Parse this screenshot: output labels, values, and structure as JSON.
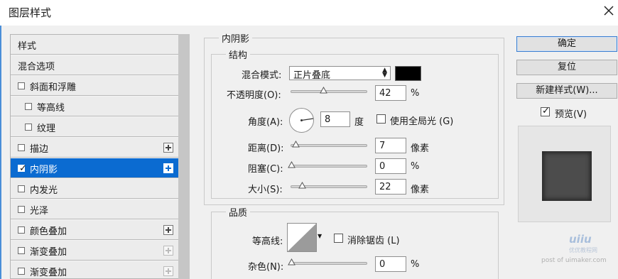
{
  "window": {
    "title": "图层样式"
  },
  "sidebar": {
    "items": [
      {
        "label": "样式",
        "type": "header"
      },
      {
        "label": "混合选项",
        "type": "header"
      },
      {
        "label": "斜面和浮雕",
        "checked": false,
        "plus": false
      },
      {
        "label": "等高线",
        "checked": false,
        "indent": true
      },
      {
        "label": "纹理",
        "checked": false,
        "indent": true
      },
      {
        "label": "描边",
        "checked": false,
        "plus": true
      },
      {
        "label": "内阴影",
        "checked": true,
        "plus": true,
        "selected": true
      },
      {
        "label": "内发光",
        "checked": false
      },
      {
        "label": "光泽",
        "checked": false
      },
      {
        "label": "颜色叠加",
        "checked": false,
        "plus": true
      },
      {
        "label": "渐变叠加",
        "checked": false,
        "plus": true,
        "dim": true
      },
      {
        "label": "渐变叠加",
        "checked": false,
        "plus": true,
        "dim": true
      }
    ]
  },
  "panel": {
    "section_title": "内阴影",
    "structure": {
      "legend": "结构",
      "blend_mode_label": "混合模式:",
      "blend_mode_value": "正片叠底",
      "blend_color": "#000000",
      "opacity_label": "不透明度(O):",
      "opacity_value": "42",
      "opacity_unit": "%",
      "angle_label": "角度(A):",
      "angle_value": "8",
      "angle_unit": "度",
      "global_light_label": "使用全局光 (G)",
      "global_light_checked": false,
      "distance_label": "距离(D):",
      "distance_value": "7",
      "distance_unit": "像素",
      "choke_label": "阻塞(C):",
      "choke_value": "0",
      "choke_unit": "%",
      "size_label": "大小(S):",
      "size_value": "22",
      "size_unit": "像素"
    },
    "quality": {
      "legend": "品质",
      "contour_label": "等高线:",
      "antialias_label": "消除锯齿 (L)",
      "antialias_checked": false,
      "noise_label": "杂色(N):",
      "noise_value": "0",
      "noise_unit": "%"
    }
  },
  "actions": {
    "ok_label": "确定",
    "reset_label": "复位",
    "new_style_label": "新建样式(W)...",
    "preview_label": "预览(V)",
    "preview_checked": true
  },
  "watermark": {
    "logo": "uiiu",
    "sub": "优优教程网",
    "url": "post of uimaker.com"
  }
}
